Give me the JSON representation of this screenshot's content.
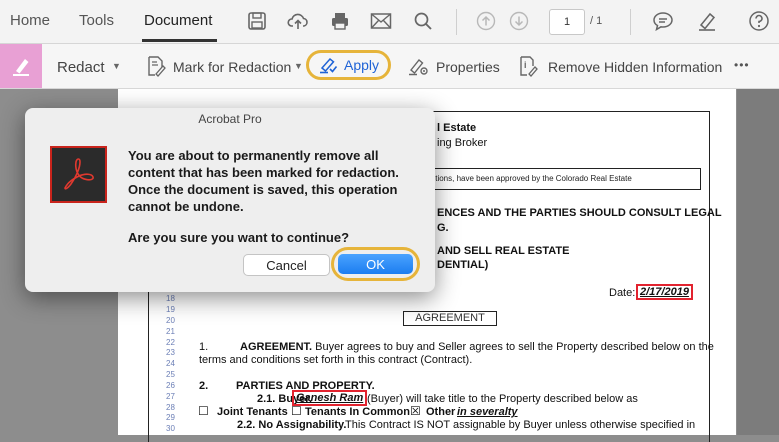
{
  "tabs": {
    "home": "Home",
    "tools": "Tools",
    "document": "Document"
  },
  "pager": {
    "current": "1",
    "total": "/ 1"
  },
  "toolbar": {
    "redact": "Redact",
    "mark": "Mark for Redaction",
    "apply": "Apply",
    "properties": "Properties",
    "remove_hidden": "Remove Hidden Information",
    "more": "•••"
  },
  "document": {
    "heading1": "l Estate",
    "heading2": "ing Broker",
    "notice": "ditions, have been approved by the Colorado Real Estate",
    "legal1": "ENCES AND THE PARTIES SHOULD CONSULT LEGAL",
    "legal2": "G.",
    "sell1": "AND SELL REAL ESTATE",
    "sell2": "DENTIAL)",
    "date_label": "Date:",
    "date_value": "2/17/2019",
    "agreement_title": "AGREEMENT",
    "line_numbers": [
      "18",
      "19",
      "20",
      "21",
      "22",
      "23",
      "24",
      "25",
      "26",
      "27",
      "28",
      "29",
      "30"
    ],
    "p1_num": "1.",
    "p1_head": "AGREEMENT.",
    "p1_text": " Buyer agrees to buy and Seller agrees to sell the Property described below on the",
    "p1_cont": "terms and conditions set forth in this contract (Contract).",
    "p2_num": "2.",
    "p2_head": "PARTIES AND PROPERTY.",
    "p21_label": "2.1. Buyer.",
    "buyer_name": "Ganesh Ram",
    "p21_text": "(Buyer) will take title to the Property described below as",
    "joint": "Joint Tenants",
    "common": "Tenants In Common",
    "other": "Other",
    "severalty": "in severalty",
    "p22_label": "2.2. No Assignability.",
    "p22_text": "This Contract IS NOT assignable by Buyer unless otherwise specified in"
  },
  "dialog": {
    "title": "Acrobat Pro",
    "message": "You are about to permanently remove all\ncontent that has been marked for redaction.\nOnce the document is saved, this operation\ncannot be undone.",
    "question": "Are you sure you want to continue?",
    "cancel": "Cancel",
    "ok": "OK"
  },
  "colors": {
    "accent": "#1f63d6",
    "highlight": "#e6b43a",
    "redact_tool": "#e8a0d4",
    "redaction_box": "#e2232f"
  }
}
